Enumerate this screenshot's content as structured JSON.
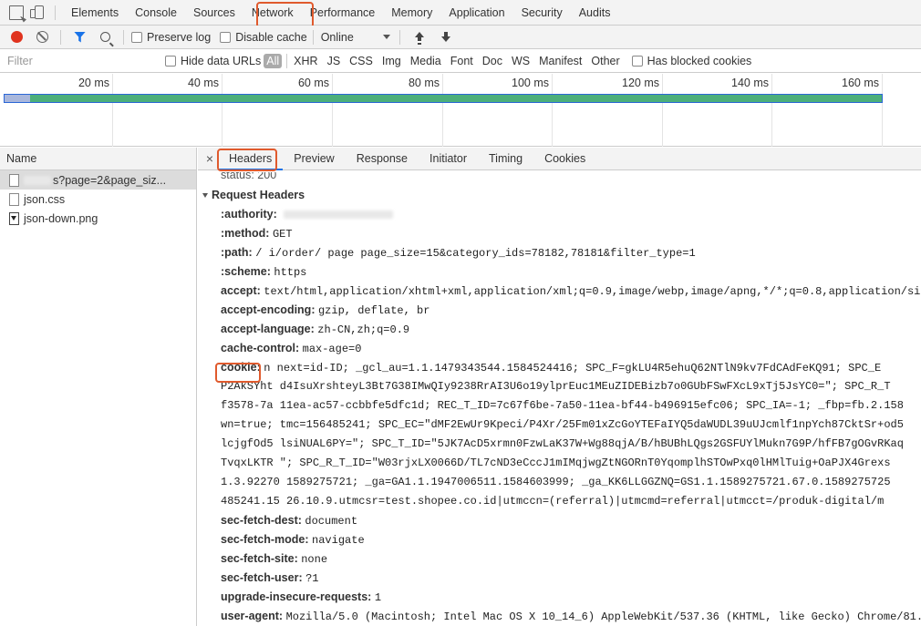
{
  "devtools": {
    "panels": [
      "Elements",
      "Console",
      "Sources",
      "Network",
      "Performance",
      "Memory",
      "Application",
      "Security",
      "Audits"
    ],
    "active_panel": "Network"
  },
  "network_toolbar": {
    "preserve_log": "Preserve log",
    "disable_cache": "Disable cache",
    "throttling": "Online"
  },
  "filter_bar": {
    "placeholder": "Filter",
    "hide_data_urls": "Hide data URLs",
    "all": "All",
    "types": [
      "XHR",
      "JS",
      "CSS",
      "Img",
      "Media",
      "Font",
      "Doc",
      "WS",
      "Manifest",
      "Other"
    ],
    "has_blocked_cookies": "Has blocked cookies"
  },
  "timeline": {
    "ticks": [
      "20 ms",
      "40 ms",
      "60 ms",
      "80 ms",
      "100 ms",
      "120 ms",
      "140 ms",
      "160 ms"
    ]
  },
  "requests": {
    "header": "Name",
    "items": [
      {
        "name": "s?page=2&page_siz..."
      },
      {
        "name": "json.css"
      },
      {
        "name": "json-down.png"
      }
    ]
  },
  "details": {
    "tabs": [
      "Headers",
      "Preview",
      "Response",
      "Initiator",
      "Timing",
      "Cookies"
    ],
    "active_tab": "Headers",
    "status_partial": "status: 200",
    "request_headers_title": "Request Headers",
    "headers": [
      {
        "key": ":authority:",
        "value": ""
      },
      {
        "key": ":method:",
        "value": "GET"
      },
      {
        "key": ":path:",
        "value": "/      i/order/           page  page_size=15&category_ids=78182,78181&filter_type=1"
      },
      {
        "key": ":scheme:",
        "value": "https"
      },
      {
        "key": "accept:",
        "value": "text/html,application/xhtml+xml,application/xml;q=0.9,image/webp,image/apng,*/*;q=0.8,application/si"
      },
      {
        "key": "accept-encoding:",
        "value": "gzip, deflate, br"
      },
      {
        "key": "accept-language:",
        "value": "zh-CN,zh;q=0.9"
      },
      {
        "key": "cache-control:",
        "value": "max-age=0"
      }
    ],
    "cookie_key": "cookie:",
    "cookie_lines": [
      "n   next=id-ID; _gcl_au=1.1.1479343544.1584524416; SPC_F=gkLU4R5ehuQ62NTlN9kv7FdCAdFeKQ91; SPC_E",
      "P2AkSYht   d4IsuXrshteyL3Bt7G38IMwQIy9238RrAI3U6o19ylprEuc1MEuZIDEBizb7o0GUbFSwFXcL9xTj5JsYC0=\"; SPC_R_T",
      "f3578-7a  11ea-ac57-ccbbfe5dfc1d; REC_T_ID=7c67f6be-7a50-11ea-bf44-b496915efc06; SPC_IA=-1; _fbp=fb.2.158",
      "wn=true;   tmc=156485241; SPC_EC=\"dMF2EwUr9Kpeci/P4Xr/25Fm01xZcGoYTEFaIYQ5daWUDL39uUJcmlf1npYch87CktSr+od5",
      "lcjgfOd5   lsiNUAL6PY=\"; SPC_T_ID=\"5JK7AcD5xrmn0FzwLaK37W+Wg88qjA/B/hBUBhLQgs2GSFUYlMukn7G9P/hfFB7gOGvRKaq",
      "TvqxLKTR    \"; SPC_R_T_ID=\"W03rjxLX0066D/TL7cND3eCccJ1mIMqjwgZtNGORnT0YqomplhSTOwPxq0lHMlTuig+OaPJX4Grexs",
      "1.3.92270     1589275721; _ga=GA1.1.1947006511.1584603999; _ga_KK6LLGGZNQ=GS1.1.1589275721.67.0.1589275725",
      "485241.15    26.10.9.utmcsr=test.shopee.co.id|utmccn=(referral)|utmcmd=referral|utmcct=/produk-digital/m"
    ],
    "headers_after": [
      {
        "key": "sec-fetch-dest:",
        "value": "document"
      },
      {
        "key": "sec-fetch-mode:",
        "value": "navigate"
      },
      {
        "key": "sec-fetch-site:",
        "value": "none"
      },
      {
        "key": "sec-fetch-user:",
        "value": "?1"
      },
      {
        "key": "upgrade-insecure-requests:",
        "value": "1"
      },
      {
        "key": "user-agent:",
        "value": "Mozilla/5.0 (Macintosh; Intel Mac OS X 10_14_6) AppleWebKit/537.36 (KHTML, like Gecko) Chrome/81."
      }
    ]
  },
  "colors": {
    "highlight_box": "#e05a2d",
    "record": "#e0331e",
    "filter_active": "#1a73e8",
    "waterfall_bar": "#4caf7a",
    "waterfall_border": "#2b67d6"
  }
}
